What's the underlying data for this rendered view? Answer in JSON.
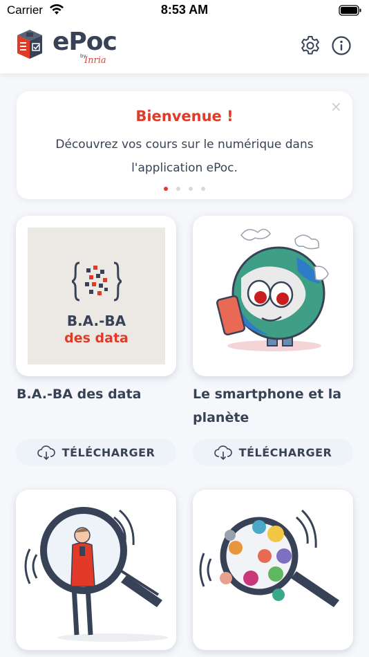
{
  "status_bar": {
    "carrier": "Carrier",
    "time": "8:53 AM"
  },
  "header": {
    "brand": "ePoc",
    "by": "by",
    "company": "Inria"
  },
  "welcome": {
    "title": "Bienvenue !",
    "text": "Découvrez vos cours sur le numérique dans l'application ePoc.",
    "close_label": "×",
    "page_count": 4,
    "active_page": 1
  },
  "cover_baba": {
    "title": "B.A.-BA",
    "subtitle": "des data"
  },
  "courses": [
    {
      "title": "B.A.-BA des data",
      "action": "TÉLÉCHARGER"
    },
    {
      "title": "Le smartphone et la planète",
      "action": "TÉLÉCHARGER"
    }
  ],
  "colors": {
    "accent": "#e13a28",
    "text": "#384257",
    "background": "#f5f7fb",
    "button_background": "#eef2f9"
  },
  "icons": [
    "wifi-icon",
    "battery-icon",
    "epoc-logo-icon",
    "gear-icon",
    "info-icon",
    "close-icon",
    "cloud-download-icon"
  ]
}
